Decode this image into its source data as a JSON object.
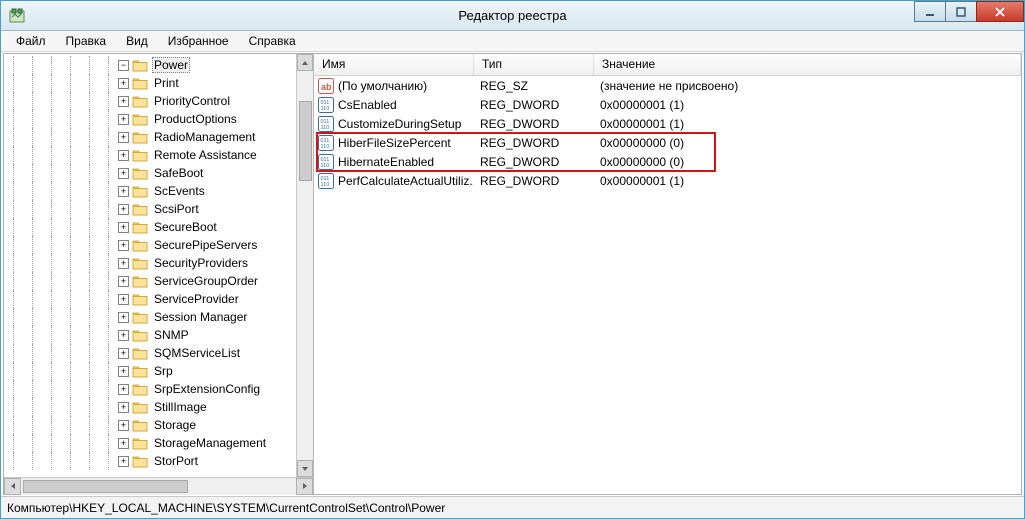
{
  "window": {
    "title": "Редактор реестра"
  },
  "menu": {
    "file": "Файл",
    "edit": "Правка",
    "view": "Вид",
    "favorites": "Избранное",
    "help": "Справка"
  },
  "tree_items": [
    {
      "label": "Power",
      "selected": true,
      "expanded": true
    },
    {
      "label": "Print"
    },
    {
      "label": "PriorityControl"
    },
    {
      "label": "ProductOptions"
    },
    {
      "label": "RadioManagement"
    },
    {
      "label": "Remote Assistance"
    },
    {
      "label": "SafeBoot"
    },
    {
      "label": "ScEvents"
    },
    {
      "label": "ScsiPort"
    },
    {
      "label": "SecureBoot"
    },
    {
      "label": "SecurePipeServers"
    },
    {
      "label": "SecurityProviders"
    },
    {
      "label": "ServiceGroupOrder"
    },
    {
      "label": "ServiceProvider"
    },
    {
      "label": "Session Manager"
    },
    {
      "label": "SNMP"
    },
    {
      "label": "SQMServiceList"
    },
    {
      "label": "Srp"
    },
    {
      "label": "SrpExtensionConfig"
    },
    {
      "label": "StillImage"
    },
    {
      "label": "Storage"
    },
    {
      "label": "StorageManagement"
    },
    {
      "label": "StorPort"
    }
  ],
  "columns": {
    "name": "Имя",
    "type": "Тип",
    "value": "Значение"
  },
  "values": [
    {
      "icon": "string",
      "name": "(По умолчанию)",
      "type": "REG_SZ",
      "value": "(значение не присвоено)",
      "hl": false
    },
    {
      "icon": "binary",
      "name": "CsEnabled",
      "type": "REG_DWORD",
      "value": "0x00000001 (1)",
      "hl": false
    },
    {
      "icon": "binary",
      "name": "CustomizeDuringSetup",
      "type": "REG_DWORD",
      "value": "0x00000001 (1)",
      "hl": false
    },
    {
      "icon": "binary",
      "name": "HiberFileSizePercent",
      "type": "REG_DWORD",
      "value": "0x00000000 (0)",
      "hl": true
    },
    {
      "icon": "binary",
      "name": "HibernateEnabled",
      "type": "REG_DWORD",
      "value": "0x00000000 (0)",
      "hl": true
    },
    {
      "icon": "binary",
      "name": "PerfCalculateActualUtiliz...",
      "type": "REG_DWORD",
      "value": "0x00000001 (1)",
      "hl": false
    }
  ],
  "statusbar": {
    "path": "Компьютер\\HKEY_LOCAL_MACHINE\\SYSTEM\\CurrentControlSet\\Control\\Power"
  }
}
